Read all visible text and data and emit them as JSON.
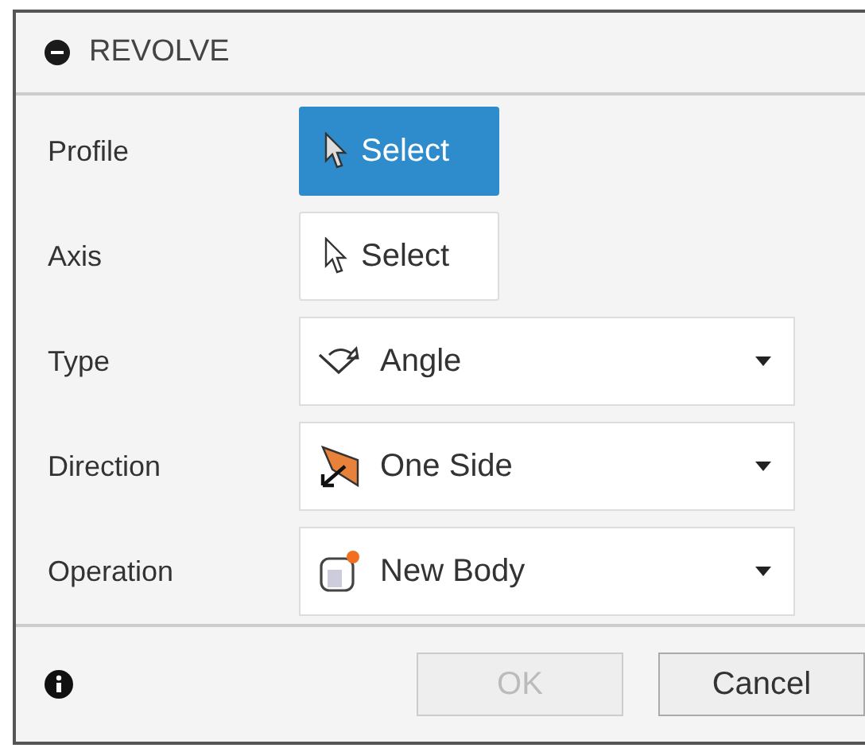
{
  "window": {
    "title": "REVOLVE"
  },
  "rows": [
    {
      "label": "Profile",
      "kind": "select",
      "value": "Select",
      "selected": true
    },
    {
      "label": "Axis",
      "kind": "select",
      "value": "Select",
      "selected": false
    },
    {
      "label": "Type",
      "kind": "dropdown",
      "value": "Angle"
    },
    {
      "label": "Direction",
      "kind": "dropdown",
      "value": "One Side"
    },
    {
      "label": "Operation",
      "kind": "dropdown",
      "value": "New Body"
    }
  ],
  "footer": {
    "buttons": [
      {
        "label": "OK",
        "disabled": true
      },
      {
        "label": "Cancel",
        "disabled": false
      }
    ]
  }
}
